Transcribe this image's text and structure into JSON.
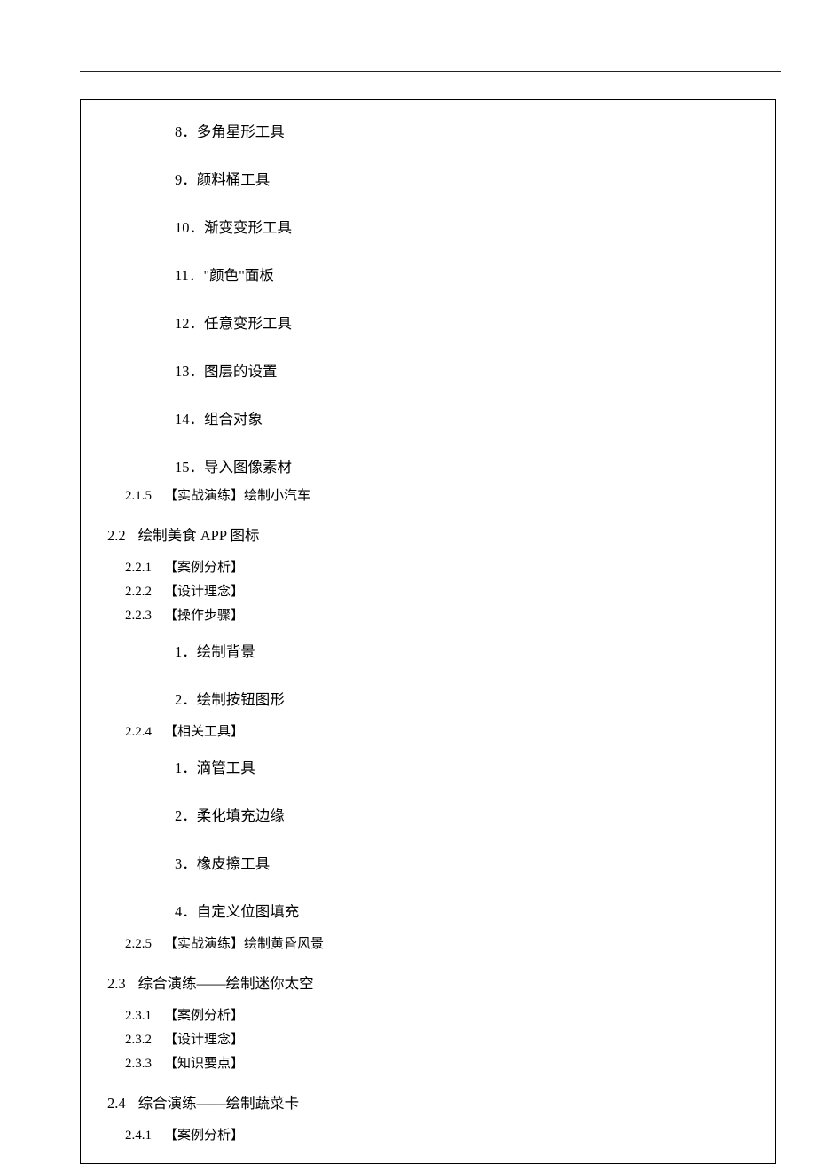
{
  "items_top": [
    {
      "n": "8",
      "t": "．多角星形工具"
    },
    {
      "n": "9",
      "t": "．颜料桶工具"
    },
    {
      "n": "10",
      "t": "．渐变变形工具"
    },
    {
      "n": "11",
      "t": "．\"颜色\"面板"
    },
    {
      "n": "12",
      "t": "．任意变形工具"
    },
    {
      "n": "13",
      "t": "．图层的设置"
    },
    {
      "n": "14",
      "t": "．组合对象"
    },
    {
      "n": "15",
      "t": "．导入图像素材"
    }
  ],
  "s215": {
    "idx": "2.1.5",
    "label": "【实战演练】绘制小汽车"
  },
  "s22": {
    "num": "2.2",
    "title": "绘制美食 APP 图标"
  },
  "s221": {
    "idx": "2.2.1",
    "label": "【案例分析】"
  },
  "s222": {
    "idx": "2.2.2",
    "label": "【设计理念】"
  },
  "s223": {
    "idx": "2.2.3",
    "label": "【操作步骤】"
  },
  "items_223": [
    {
      "n": "1",
      "t": "．绘制背景"
    },
    {
      "n": "2",
      "t": "．绘制按钮图形"
    }
  ],
  "s224": {
    "idx": "2.2.4",
    "label": "【相关工具】"
  },
  "items_224": [
    {
      "n": "1",
      "t": "．滴管工具"
    },
    {
      "n": "2",
      "t": "．柔化填充边缘"
    },
    {
      "n": "3",
      "t": "．橡皮擦工具"
    },
    {
      "n": "4",
      "t": "．自定义位图填充"
    }
  ],
  "s225": {
    "idx": "2.2.5",
    "label": "【实战演练】绘制黄昏风景"
  },
  "s23": {
    "num": "2.3",
    "title": "综合演练——绘制迷你太空"
  },
  "s231": {
    "idx": "2.3.1",
    "label": "【案例分析】"
  },
  "s232": {
    "idx": "2.3.2",
    "label": "【设计理念】"
  },
  "s233": {
    "idx": "2.3.3",
    "label": "【知识要点】"
  },
  "s24": {
    "num": "2.4",
    "title": "综合演练——绘制蔬菜卡"
  },
  "s241": {
    "idx": "2.4.1",
    "label": "【案例分析】"
  }
}
